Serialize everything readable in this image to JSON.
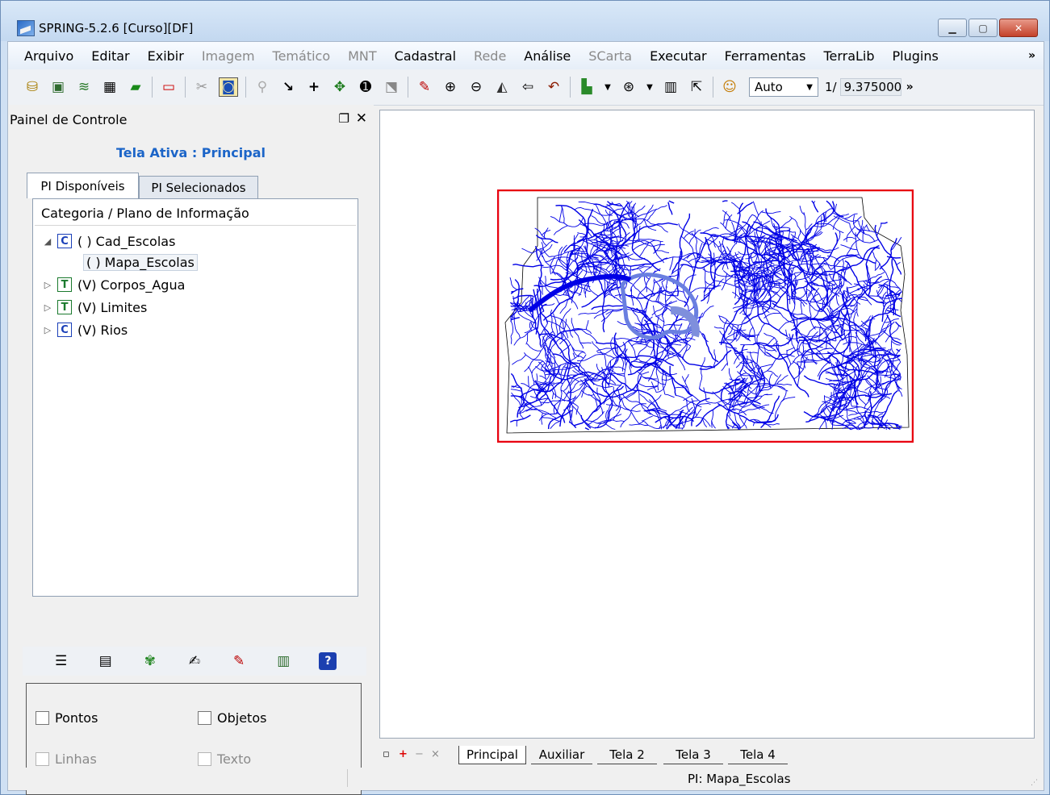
{
  "window": {
    "title": "SPRING-5.2.6 [Curso][DF]"
  },
  "menu": [
    {
      "label": "Arquivo",
      "enabled": true
    },
    {
      "label": "Editar",
      "enabled": true
    },
    {
      "label": "Exibir",
      "enabled": true
    },
    {
      "label": "Imagem",
      "enabled": false
    },
    {
      "label": "Temático",
      "enabled": false
    },
    {
      "label": "MNT",
      "enabled": false
    },
    {
      "label": "Cadastral",
      "enabled": true
    },
    {
      "label": "Rede",
      "enabled": false
    },
    {
      "label": "Análise",
      "enabled": true
    },
    {
      "label": "SCarta",
      "enabled": false
    },
    {
      "label": "Executar",
      "enabled": true
    },
    {
      "label": "Ferramentas",
      "enabled": true
    },
    {
      "label": "TerraLib",
      "enabled": true
    },
    {
      "label": "Plugins",
      "enabled": true
    }
  ],
  "menu_more": "»",
  "toolbar": {
    "auto_value": "Auto",
    "scale_prefix": "1/",
    "scale_value": "9.375000",
    "more": "»"
  },
  "panel": {
    "title": "Painel de Controle",
    "active_screen": "Tela Ativa : Principal",
    "tabs": [
      "PI Disponíveis",
      "PI Selecionados"
    ],
    "tree_header": "Categoria / Plano de Informação",
    "tree": [
      {
        "badge": "C",
        "label": "( ) Cad_Escolas",
        "expander": "◢"
      },
      {
        "badge": "",
        "label": "( ) Mapa_Escolas",
        "expander": ""
      },
      {
        "badge": "T",
        "label": "(V) Corpos_Agua",
        "expander": "▷"
      },
      {
        "badge": "T",
        "label": "(V) Limites",
        "expander": "▷"
      },
      {
        "badge": "C",
        "label": "(V) Rios",
        "expander": "▷"
      }
    ],
    "checkboxes": {
      "pontos": "Pontos",
      "objetos": "Objetos",
      "linhas": "Linhas",
      "texto": "Texto"
    }
  },
  "bottom_tabs": [
    "Principal",
    "Auxiliar",
    "Tela 2",
    "Tela 3",
    "Tela 4"
  ],
  "status": {
    "pi": "PI: Mapa_Escolas"
  },
  "colors": {
    "rivers": "#0000e6",
    "frame": "#e8000f",
    "lake": "#7f8fdc",
    "active_label": "#1c65c8"
  }
}
